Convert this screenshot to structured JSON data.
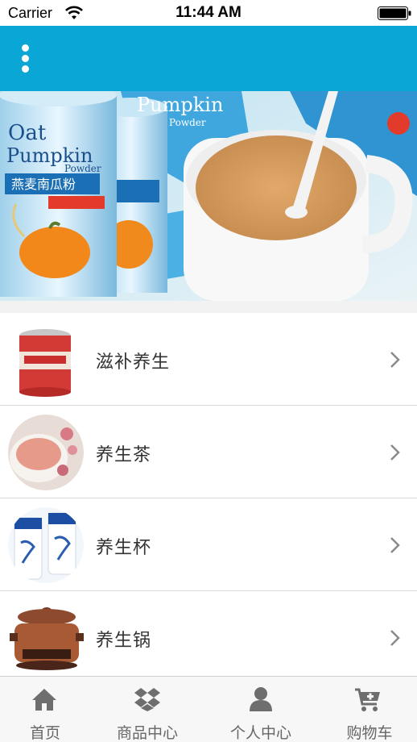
{
  "status_bar": {
    "carrier": "Carrier",
    "time": "11:44 AM"
  },
  "header": {
    "menu_icon": "vertical-ellipsis-icon",
    "background_color": "#0aa6d6"
  },
  "banner": {
    "product_text_line1": "Oat",
    "product_text_line2": "Pumpkin",
    "product_text_sub": "Powder",
    "product_cn": "燕麦南瓜粉",
    "bag_text": "Pumpkin",
    "bag_sub": "Powder",
    "slides": 3,
    "active_slide": 1
  },
  "list": {
    "items": [
      {
        "label": "滋补养生",
        "icon": "chevron-right-icon"
      },
      {
        "label": "养生茶",
        "icon": "chevron-right-icon"
      },
      {
        "label": "养生杯",
        "icon": "chevron-right-icon"
      },
      {
        "label": "养生锅",
        "icon": "chevron-right-icon"
      }
    ]
  },
  "tabbar": {
    "tabs": [
      {
        "label": "首页",
        "icon": "home-icon"
      },
      {
        "label": "商品中心",
        "icon": "dropbox-icon"
      },
      {
        "label": "个人中心",
        "icon": "user-icon"
      },
      {
        "label": "购物车",
        "icon": "cart-add-icon"
      }
    ]
  }
}
